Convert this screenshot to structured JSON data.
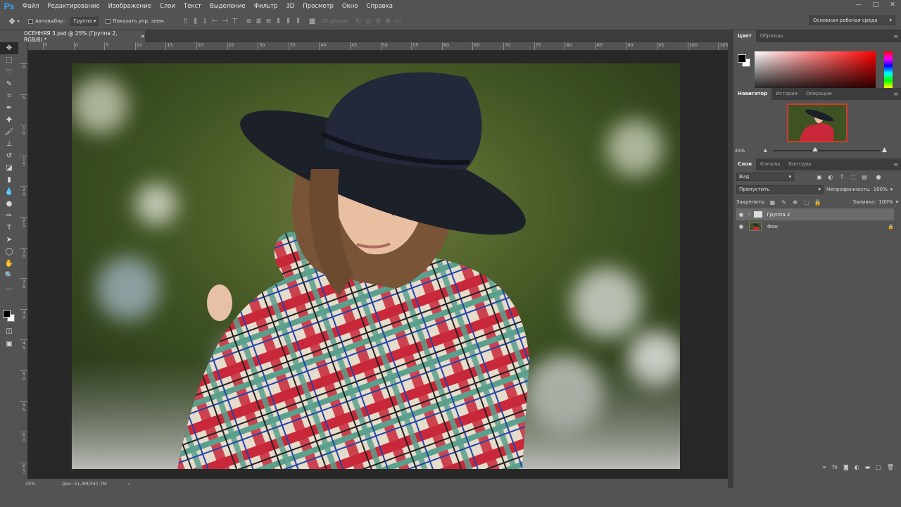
{
  "app": {
    "logo": "Ps"
  },
  "menu": [
    "Файл",
    "Редактирование",
    "Изображение",
    "Слои",
    "Текст",
    "Выделение",
    "Фильтр",
    "3D",
    "Просмотр",
    "Окно",
    "Справка"
  ],
  "window_controls": [
    "—",
    "□",
    "✕"
  ],
  "options": {
    "autoselect_label": "Автовыбор:",
    "autoselect_target": "Группа",
    "show_transform_label": "Показать упр. элем.",
    "mode_3d_label": "3D-режим:",
    "workspace": "Основная рабочая среда"
  },
  "document_tab": {
    "title": "ОСЕННЯЯ 3.psd @ 25% (Группа 2, RGB/8) *",
    "close": "×"
  },
  "ruler_h": [
    "5",
    "0",
    "5",
    "10",
    "15",
    "20",
    "25",
    "30",
    "35",
    "40",
    "45",
    "50",
    "55",
    "60",
    "65",
    "70",
    "75",
    "80",
    "85",
    "90",
    "95",
    "100",
    "105"
  ],
  "ruler_v": [
    "0",
    "5",
    "1\n0",
    "1\n5",
    "2\n0",
    "2\n5",
    "3\n0",
    "3\n5",
    "4\n0",
    "4\n5",
    "5\n0",
    "5\n5",
    "6\n0",
    "6\n5"
  ],
  "status": {
    "zoom": "25%",
    "doc": "Док: 51,3M/347,7M",
    "arrow": "›"
  },
  "color_panel": {
    "tabs": [
      "Цвет",
      "Образцы"
    ],
    "foreground": "#000000",
    "background": "#ffffff"
  },
  "navigator_panel": {
    "tabs": [
      "Навигатор",
      "История",
      "Операции"
    ],
    "zoom": "25%"
  },
  "layers_panel": {
    "tabs": [
      "Слои",
      "Каналы",
      "Контуры"
    ],
    "filter_kind": "Вид",
    "blend_mode": "Пропустить",
    "opacity_label": "Непрозрачность:",
    "opacity_value": "100%",
    "lock_label": "Закрепить:",
    "fill_label": "Заливка:",
    "fill_value": "100%",
    "layers": [
      {
        "name": "Группа 2",
        "type": "group",
        "visible": true,
        "selected": true
      },
      {
        "name": "Фон",
        "type": "image",
        "visible": true,
        "locked": true
      }
    ]
  },
  "tools": [
    "move-icon",
    "marquee-icon",
    "lasso-icon",
    "quick-select-icon",
    "crop-icon",
    "eyedropper-icon",
    "healing-icon",
    "brush-icon",
    "stamp-icon",
    "history-brush-icon",
    "eraser-icon",
    "gradient-icon",
    "blur-icon",
    "dodge-icon",
    "pen-icon",
    "type-icon",
    "path-select-icon",
    "shape-icon",
    "hand-icon",
    "zoom-icon",
    "more-icon"
  ]
}
